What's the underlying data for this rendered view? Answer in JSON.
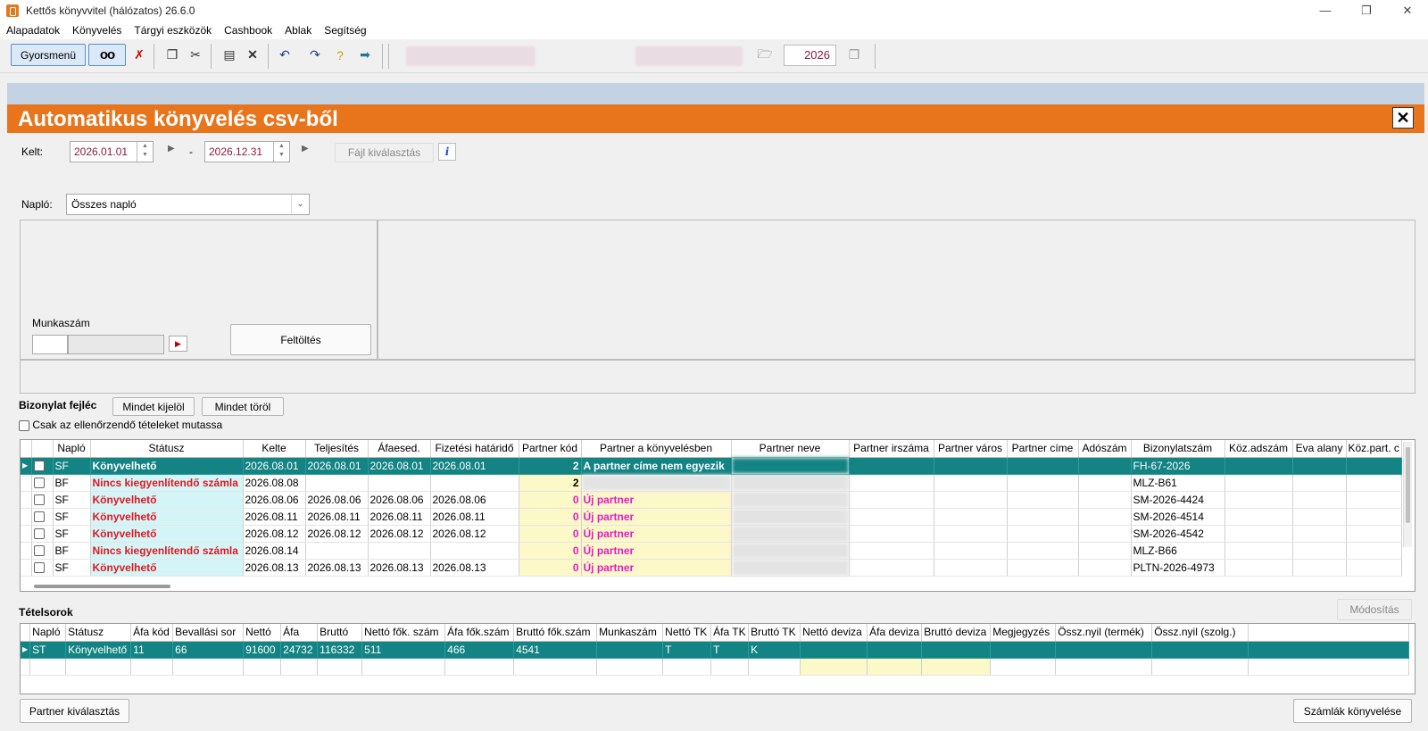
{
  "window": {
    "title": "Kettős könyvvitel (hálózatos) 26.6.0"
  },
  "menu": [
    "Alapadatok",
    "Könyvelés",
    "Tárgyi eszközök",
    "Cashbook",
    "Ablak",
    "Segítség"
  ],
  "toolbar": {
    "quick_menu": "Gyorsmenü",
    "glasses": "oo",
    "year": "2026"
  },
  "form": {
    "title": "Automatikus könyvelés csv-ből",
    "kelt_label": "Kelt:",
    "date_from": "2026.01.01",
    "date_sep": "-",
    "date_to": "2026.12.31",
    "file_select": "Fájl kiválasztás",
    "info": "i",
    "naplo_label": "Napló:",
    "naplo_value": "Összes napló",
    "munkaszam_label": "Munkaszám",
    "upload": "Feltöltés"
  },
  "header_section": {
    "label": "Bizonylat fejléc",
    "select_all": "Mindet kijelöl",
    "delete_all": "Mindet töröl",
    "check_only": "Csak az ellenőrzendő tételeket mutassa"
  },
  "header_table": {
    "columns": [
      "Napló",
      "Státusz",
      "Kelte",
      "Teljesítés",
      "Áfaesed.",
      "Fizetési határidő",
      "Partner kód",
      "Partner a könyvelésben",
      "Partner neve",
      "Partner irszáma",
      "Partner város",
      "Partner címe",
      "Adószám",
      "Bizonylatszám",
      "Köz.adszám",
      "Eva alany",
      "Köz.part. c"
    ],
    "rows": [
      {
        "naplo": "SF",
        "status": "Könyvelhető",
        "kelte": "2026.08.01",
        "telj": "2026.08.01",
        "afa": "2026.08.01",
        "fiz": "2026.08.01",
        "pkod": "2",
        "pkonyv": "A partner címe nem egyezik",
        "bizonylat": "FH-67-2026"
      },
      {
        "naplo": "BF",
        "status": "Nincs kiegyenlítendő számla",
        "kelte": "2026.08.08",
        "telj": "",
        "afa": "",
        "fiz": "",
        "pkod": "2",
        "pkonyv": "",
        "bizonylat": "MLZ-B61"
      },
      {
        "naplo": "SF",
        "status": "Könyvelhető",
        "kelte": "2026.08.06",
        "telj": "2026.08.06",
        "afa": "2026.08.06",
        "fiz": "2026.08.06",
        "pkod": "0",
        "pkonyv": "Új partner",
        "bizonylat": "SM-2026-4424"
      },
      {
        "naplo": "SF",
        "status": "Könyvelhető",
        "kelte": "2026.08.11",
        "telj": "2026.08.11",
        "afa": "2026.08.11",
        "fiz": "2026.08.11",
        "pkod": "0",
        "pkonyv": "Új partner",
        "bizonylat": "SM-2026-4514"
      },
      {
        "naplo": "SF",
        "status": "Könyvelhető",
        "kelte": "2026.08.12",
        "telj": "2026.08.12",
        "afa": "2026.08.12",
        "fiz": "2026.08.12",
        "pkod": "0",
        "pkonyv": "Új partner",
        "bizonylat": "SM-2026-4542"
      },
      {
        "naplo": "BF",
        "status": "Nincs kiegyenlítendő számla",
        "kelte": "2026.08.14",
        "telj": "",
        "afa": "",
        "fiz": "",
        "pkod": "0",
        "pkonyv": "Új partner",
        "bizonylat": "MLZ-B66"
      },
      {
        "naplo": "SF",
        "status": "Könyvelhető",
        "kelte": "2026.08.13",
        "telj": "2026.08.13",
        "afa": "2026.08.13",
        "fiz": "2026.08.13",
        "pkod": "0",
        "pkonyv": "Új partner",
        "bizonylat": "PLTN-2026-4973"
      }
    ]
  },
  "items_section": {
    "label": "Tételsorok",
    "modify": "Módosítás"
  },
  "items_table": {
    "columns": [
      "Napló",
      "Státusz",
      "Áfa kód",
      "Bevallási sor",
      "Nettó",
      "Áfa",
      "Bruttó",
      "Nettó fők. szám",
      "Áfa fők.szám",
      "Bruttó fők.szám",
      "Munkaszám",
      "Nettó TK",
      "Áfa TK",
      "Bruttó TK",
      "Nettó deviza",
      "Áfa deviza",
      "Bruttó deviza",
      "Megjegyzés",
      "Össz.nyil (termék)",
      "Össz.nyil (szolg.)"
    ],
    "row": [
      "ST",
      "Könyvelhető",
      "11",
      "66",
      "91600",
      "24732",
      "116332",
      "511",
      "466",
      "4541",
      "",
      "T",
      "T",
      "K",
      "",
      "",
      "",
      "",
      "",
      ""
    ]
  },
  "footer": {
    "partner_select": "Partner kiválasztás",
    "post_invoices": "Számlák könyvelése"
  }
}
